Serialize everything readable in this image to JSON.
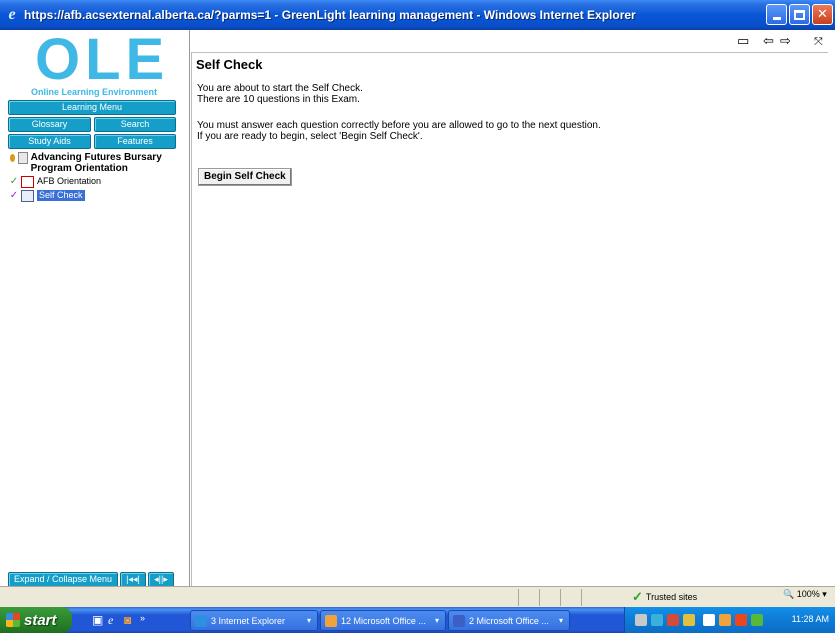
{
  "window": {
    "title": "https://afb.acsexternal.alberta.ca/?parms=1 - GreenLight learning management - Windows Internet Explorer"
  },
  "sidebar": {
    "logo": "OLE",
    "logo_subtitle": "Online Learning Environment",
    "buttons": {
      "learning_menu": "Learning Menu",
      "glossary": "Glossary",
      "search": "Search",
      "study_aids": "Study Aids",
      "features": "Features"
    },
    "tree": [
      {
        "label": "Advancing Futures Bursary Program Orientation",
        "type": "course"
      },
      {
        "label": "AFB Orientation",
        "type": "pdf",
        "completed": true
      },
      {
        "label": "Self Check",
        "type": "quiz",
        "selected": true
      }
    ],
    "expand_label": "Expand / Collapse Menu",
    "nav_prev": "|◂◂|",
    "nav_next": "◂||▸"
  },
  "content": {
    "heading": "Self Check",
    "line1": "You are about to start the Self Check.",
    "line2": "There are 10 questions in this Exam.",
    "line3": "You must answer each question correctly before you are allowed to go to the next question.",
    "line4": "If you are ready to begin, select 'Begin Self Check'.",
    "begin_button": "Begin Self Check"
  },
  "statusbar": {
    "zone": "Trusted sites",
    "zoom": "100%"
  },
  "taskbar": {
    "start": "start",
    "tasks": [
      {
        "label": "3 Internet Explorer",
        "color": "#2e8fe0"
      },
      {
        "label": "12 Microsoft Office ...",
        "color": "#f2a23a"
      },
      {
        "label": "2 Microsoft Office ...",
        "color": "#3b5fc5"
      }
    ],
    "clock": "11:28 AM"
  },
  "colors": {
    "accent": "#3fb8e6",
    "menu_button": "#159fc8",
    "selection": "#3a6fd8"
  }
}
